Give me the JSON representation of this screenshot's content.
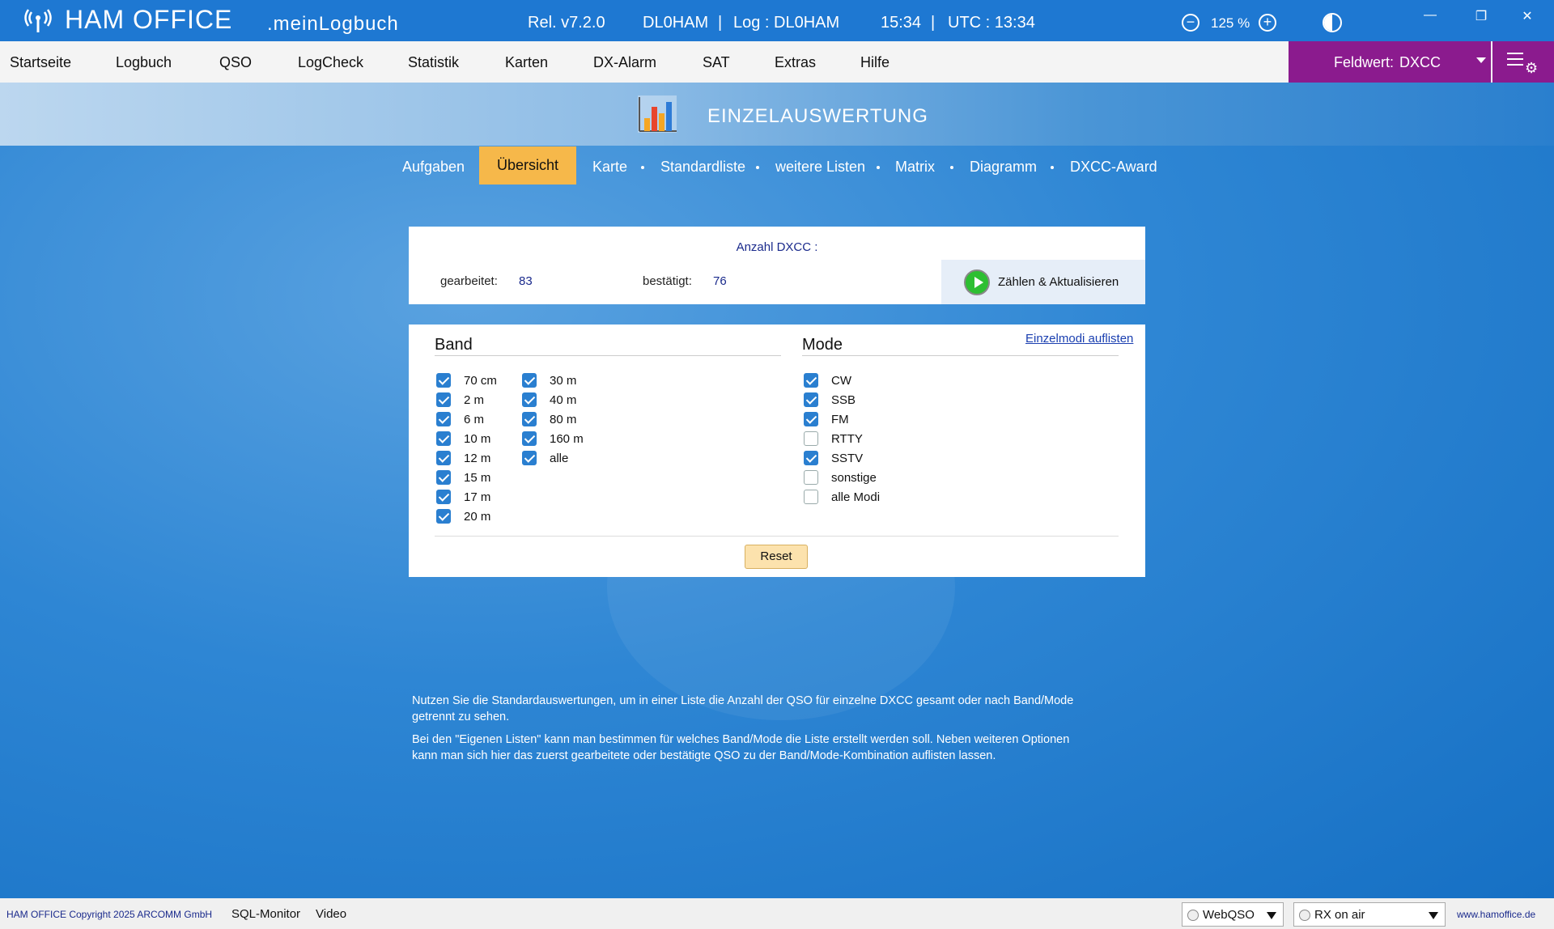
{
  "titlebar": {
    "app_title": "HAM OFFICE",
    "app_subtitle": ".meinLogbuch",
    "release": "Rel. v7.2.0",
    "callsign": "DL0HAM",
    "sep1": "|",
    "log": "Log : DL0HAM",
    "time": "15:34",
    "sep2": "|",
    "utc": "UTC : 13:34",
    "zoom_out": "−",
    "zoom_level": "125 %",
    "zoom_in": "+",
    "minimize": "—",
    "restore": "❐",
    "close": "✕"
  },
  "menu": {
    "items": [
      "Startseite",
      "Logbuch",
      "QSO",
      "LogCheck",
      "Statistik",
      "Karten",
      "DX-Alarm",
      "SAT",
      "Extras",
      "Hilfe"
    ],
    "feldwert_label": "Feldwert:",
    "feldwert_value": "DXCC",
    "gear": "⚙"
  },
  "banner": {
    "title": "EINZELAUSWERTUNG"
  },
  "tabs": {
    "items": [
      "Aufgaben",
      "Übersicht",
      "Karte",
      "Standardliste",
      "weitere Listen",
      "Matrix",
      "Diagramm",
      "DXCC-Award"
    ],
    "active": "Übersicht"
  },
  "summary": {
    "title": "Anzahl DXCC :",
    "worked_label": "gearbeitet:",
    "worked_value": "83",
    "confirmed_label": "bestätigt:",
    "confirmed_value": "76",
    "count_button": "Zählen & Aktualisieren"
  },
  "filters": {
    "band_title": "Band",
    "mode_title": "Mode",
    "einzelmodi_link": "Einzelmodi auflisten",
    "bands_col1": [
      {
        "label": "70 cm",
        "checked": true
      },
      {
        "label": "2 m",
        "checked": true
      },
      {
        "label": "6 m",
        "checked": true
      },
      {
        "label": "10 m",
        "checked": true
      },
      {
        "label": "12 m",
        "checked": true
      },
      {
        "label": "15 m",
        "checked": true
      },
      {
        "label": "17 m",
        "checked": true
      },
      {
        "label": "20 m",
        "checked": true
      }
    ],
    "bands_col2": [
      {
        "label": "30 m",
        "checked": true
      },
      {
        "label": "40 m",
        "checked": true
      },
      {
        "label": "80 m",
        "checked": true
      },
      {
        "label": "160 m",
        "checked": true
      },
      {
        "label": "alle",
        "checked": true
      }
    ],
    "modes": [
      {
        "label": "CW",
        "checked": true
      },
      {
        "label": "SSB",
        "checked": true
      },
      {
        "label": "FM",
        "checked": true
      },
      {
        "label": "RTTY",
        "checked": false
      },
      {
        "label": "SSTV",
        "checked": true
      },
      {
        "label": "sonstige",
        "checked": false
      },
      {
        "label": "alle Modi",
        "checked": false
      }
    ],
    "reset_label": "Reset"
  },
  "info": {
    "paragraph1": "Nutzen Sie die Standardauswertungen, um in einer Liste die Anzahl der QSO für einzelne DXCC gesamt  oder nach Band/Mode getrennt zu sehen.",
    "paragraph2": "Bei den \"Eigenen Listen\" kann man bestimmen für welches Band/Mode die Liste erstellt werden soll. Neben weiteren Optionen  kann man sich hier das zuerst gearbeitete oder bestätigte QSO zu der Band/Mode-Kombination auflisten lassen."
  },
  "statusbar": {
    "copyright": "HAM OFFICE Copyright 2025 ARCOMM GmbH",
    "sql_monitor": "SQL-Monitor",
    "video": "Video",
    "webqso": "WebQSO",
    "rx": "RX on air",
    "website": "www.hamoffice.de"
  },
  "colors": {
    "titlebar": "#1e78d2",
    "accent_purple": "#8b1b8e",
    "active_tab": "#f6b84a",
    "checkbox_on": "#2a7fd0",
    "play_green": "#2dbf32"
  }
}
